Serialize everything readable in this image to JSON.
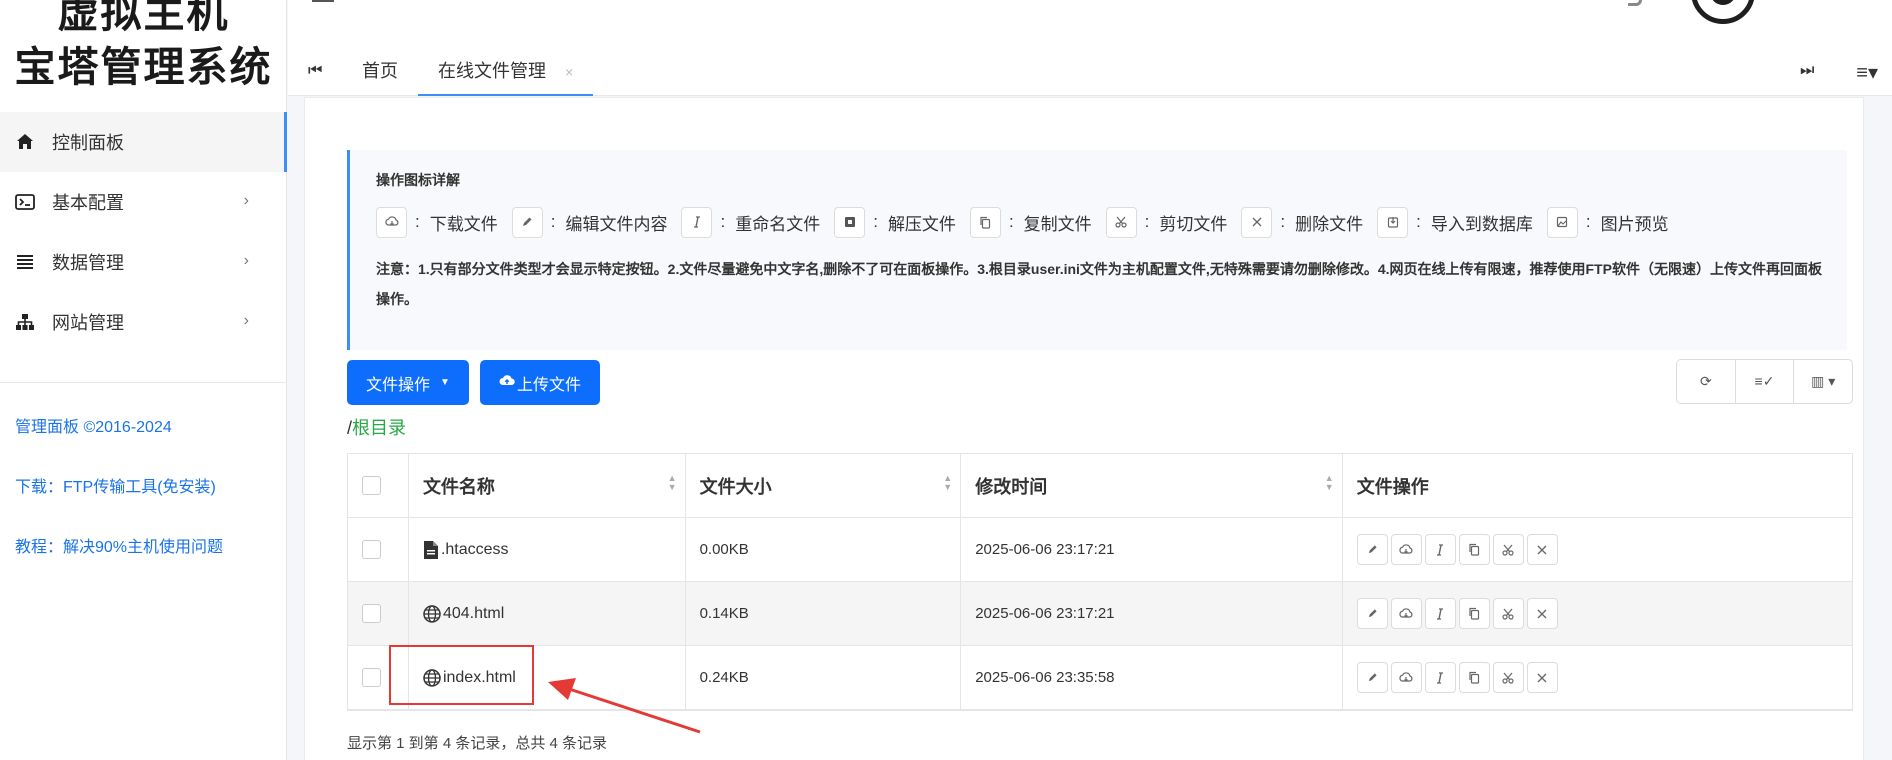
{
  "brand": {
    "line1": "虚拟主机",
    "line2": "宝塔管理系统"
  },
  "sidebar": {
    "items": [
      {
        "label": "控制面板",
        "icon": "home-icon",
        "active": true,
        "chevron": false
      },
      {
        "label": "基本配置",
        "icon": "terminal-icon",
        "active": false,
        "chevron": true
      },
      {
        "label": "数据管理",
        "icon": "list-icon",
        "active": false,
        "chevron": true
      },
      {
        "label": "网站管理",
        "icon": "sitemap-icon",
        "active": false,
        "chevron": true
      }
    ],
    "links": [
      "管理面板 ©2016-2024",
      "下载：FTP传输工具(免安装)",
      "教程：解决90%主机使用问题"
    ]
  },
  "tabs": {
    "items": [
      {
        "label": "首页",
        "active": false
      },
      {
        "label": "在线文件管理",
        "active": true,
        "close": "×"
      }
    ]
  },
  "info": {
    "title": "操作图标详解",
    "legend": [
      {
        "icon": "cloud-download-icon",
        "label": "下载文件"
      },
      {
        "icon": "pencil-icon",
        "label": "编辑文件内容"
      },
      {
        "icon": "cursor-icon",
        "label": "重命名文件"
      },
      {
        "icon": "archive-icon",
        "label": "解压文件"
      },
      {
        "icon": "copy-icon",
        "label": "复制文件"
      },
      {
        "icon": "scissors-icon",
        "label": "剪切文件"
      },
      {
        "icon": "close-icon",
        "label": "删除文件"
      },
      {
        "icon": "import-icon",
        "label": "导入到数据库"
      },
      {
        "icon": "image-icon",
        "label": "图片预览"
      }
    ],
    "note": "注意：1.只有部分文件类型才会显示特定按钮。2.文件尽量避免中文字名,删除不了可在面板操作。3.根目录user.ini文件为主机配置文件,无特殊需要请勿删除修改。4.网页在线上传有限速，推荐使用FTP软件（无限速）上传文件再回面板操作。"
  },
  "toolbar": {
    "ops_label": "文件操作",
    "upload_label": "上传文件"
  },
  "breadcrumb": {
    "slash": "/",
    "root": "根目录"
  },
  "table": {
    "headers": [
      "文件名称",
      "文件大小",
      "修改时间",
      "文件操作"
    ],
    "rows": [
      {
        "icon": "file-icon",
        "name": ".htaccess",
        "size": "0.00KB",
        "time": "2025-06-06 23:17:21"
      },
      {
        "icon": "globe-icon",
        "name": "404.html",
        "size": "0.14KB",
        "time": "2025-06-06 23:17:21"
      },
      {
        "icon": "globe-icon",
        "name": "index.html",
        "size": "0.24KB",
        "time": "2025-06-06 23:35:58"
      }
    ]
  },
  "footer": {
    "summary": "显示第 1 到第 4 条记录，总共 4 条记录"
  },
  "colors": {
    "primary": "#0d6efd",
    "accent": "#3d8ef7",
    "link": "#1a73e8",
    "green": "#28a745",
    "highlight": "#e53935"
  }
}
